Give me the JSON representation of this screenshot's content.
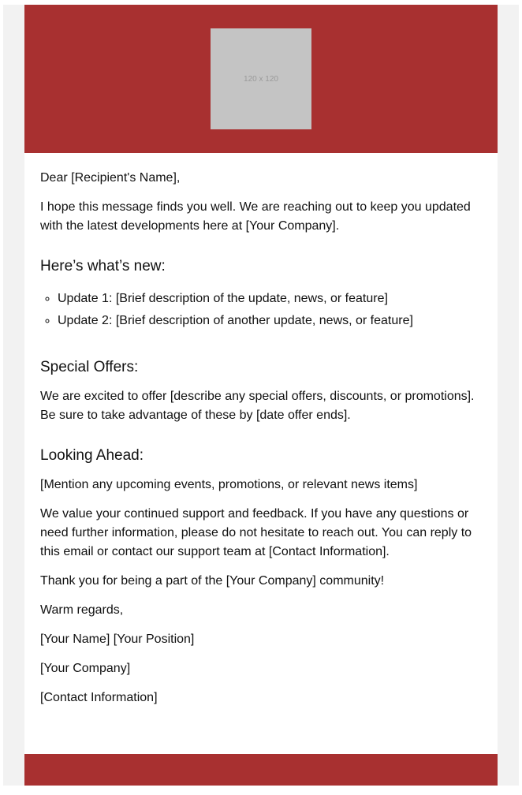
{
  "colors": {
    "brand": "#a83030",
    "background": "#f2f2f2",
    "placeholder": "#c4c4c4"
  },
  "header": {
    "logo_placeholder": "120 x 120"
  },
  "body": {
    "greeting": "Dear [Recipient's Name],",
    "intro": "I hope this message finds you well. We are reaching out to keep you updated with the latest developments here at [Your Company].",
    "whats_new": {
      "heading": "Here’s what’s new:",
      "items": [
        "Update 1: [Brief description of the update, news, or feature]",
        "Update 2: [Brief description of another update, news, or feature]"
      ]
    },
    "special_offers": {
      "heading": "Special Offers:",
      "text": "We are excited to offer [describe any special offers, discounts, or promotions]. Be sure to take advantage of these by [date offer ends]."
    },
    "looking_ahead": {
      "heading": "Looking Ahead:",
      "text": "[Mention any upcoming events, promotions, or relevant news items]"
    },
    "support": "We value your continued support and feedback. If you have any questions or need further information, please do not hesitate to reach out. You can reply to this email or contact our support team at [Contact Information].",
    "thanks": "Thank you for being a part of the [Your Company] community!",
    "signoff": "Warm regards,",
    "name_position": "[Your Name] [Your Position]",
    "company": "[Your Company]",
    "contact": "[Contact Information]"
  }
}
